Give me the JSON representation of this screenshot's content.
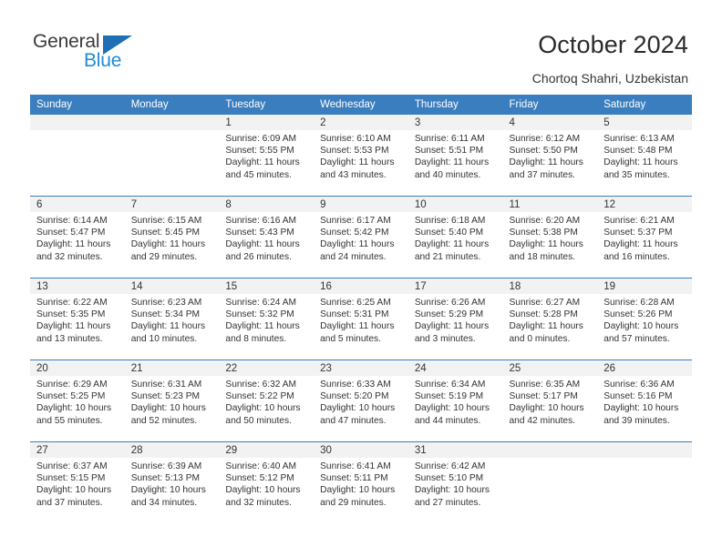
{
  "brand": {
    "name_top": "General",
    "name_bottom": "Blue",
    "accent_blue": "#1f8ad6",
    "triangle_blue": "#1f6fb5"
  },
  "header": {
    "title": "October 2024",
    "subtitle": "Chortoq Shahri, Uzbekistan",
    "header_bg": "#3a7ebf"
  },
  "calendar": {
    "weekday_headers": [
      "Sunday",
      "Monday",
      "Tuesday",
      "Wednesday",
      "Thursday",
      "Friday",
      "Saturday"
    ],
    "weeks": [
      [
        {
          "day": "",
          "sunrise": "",
          "sunset": "",
          "daylight_line1": "",
          "daylight_line2": ""
        },
        {
          "day": "",
          "sunrise": "",
          "sunset": "",
          "daylight_line1": "",
          "daylight_line2": ""
        },
        {
          "day": "1",
          "sunrise": "Sunrise: 6:09 AM",
          "sunset": "Sunset: 5:55 PM",
          "daylight_line1": "Daylight: 11 hours",
          "daylight_line2": "and 45 minutes."
        },
        {
          "day": "2",
          "sunrise": "Sunrise: 6:10 AM",
          "sunset": "Sunset: 5:53 PM",
          "daylight_line1": "Daylight: 11 hours",
          "daylight_line2": "and 43 minutes."
        },
        {
          "day": "3",
          "sunrise": "Sunrise: 6:11 AM",
          "sunset": "Sunset: 5:51 PM",
          "daylight_line1": "Daylight: 11 hours",
          "daylight_line2": "and 40 minutes."
        },
        {
          "day": "4",
          "sunrise": "Sunrise: 6:12 AM",
          "sunset": "Sunset: 5:50 PM",
          "daylight_line1": "Daylight: 11 hours",
          "daylight_line2": "and 37 minutes."
        },
        {
          "day": "5",
          "sunrise": "Sunrise: 6:13 AM",
          "sunset": "Sunset: 5:48 PM",
          "daylight_line1": "Daylight: 11 hours",
          "daylight_line2": "and 35 minutes."
        }
      ],
      [
        {
          "day": "6",
          "sunrise": "Sunrise: 6:14 AM",
          "sunset": "Sunset: 5:47 PM",
          "daylight_line1": "Daylight: 11 hours",
          "daylight_line2": "and 32 minutes."
        },
        {
          "day": "7",
          "sunrise": "Sunrise: 6:15 AM",
          "sunset": "Sunset: 5:45 PM",
          "daylight_line1": "Daylight: 11 hours",
          "daylight_line2": "and 29 minutes."
        },
        {
          "day": "8",
          "sunrise": "Sunrise: 6:16 AM",
          "sunset": "Sunset: 5:43 PM",
          "daylight_line1": "Daylight: 11 hours",
          "daylight_line2": "and 26 minutes."
        },
        {
          "day": "9",
          "sunrise": "Sunrise: 6:17 AM",
          "sunset": "Sunset: 5:42 PM",
          "daylight_line1": "Daylight: 11 hours",
          "daylight_line2": "and 24 minutes."
        },
        {
          "day": "10",
          "sunrise": "Sunrise: 6:18 AM",
          "sunset": "Sunset: 5:40 PM",
          "daylight_line1": "Daylight: 11 hours",
          "daylight_line2": "and 21 minutes."
        },
        {
          "day": "11",
          "sunrise": "Sunrise: 6:20 AM",
          "sunset": "Sunset: 5:38 PM",
          "daylight_line1": "Daylight: 11 hours",
          "daylight_line2": "and 18 minutes."
        },
        {
          "day": "12",
          "sunrise": "Sunrise: 6:21 AM",
          "sunset": "Sunset: 5:37 PM",
          "daylight_line1": "Daylight: 11 hours",
          "daylight_line2": "and 16 minutes."
        }
      ],
      [
        {
          "day": "13",
          "sunrise": "Sunrise: 6:22 AM",
          "sunset": "Sunset: 5:35 PM",
          "daylight_line1": "Daylight: 11 hours",
          "daylight_line2": "and 13 minutes."
        },
        {
          "day": "14",
          "sunrise": "Sunrise: 6:23 AM",
          "sunset": "Sunset: 5:34 PM",
          "daylight_line1": "Daylight: 11 hours",
          "daylight_line2": "and 10 minutes."
        },
        {
          "day": "15",
          "sunrise": "Sunrise: 6:24 AM",
          "sunset": "Sunset: 5:32 PM",
          "daylight_line1": "Daylight: 11 hours",
          "daylight_line2": "and 8 minutes."
        },
        {
          "day": "16",
          "sunrise": "Sunrise: 6:25 AM",
          "sunset": "Sunset: 5:31 PM",
          "daylight_line1": "Daylight: 11 hours",
          "daylight_line2": "and 5 minutes."
        },
        {
          "day": "17",
          "sunrise": "Sunrise: 6:26 AM",
          "sunset": "Sunset: 5:29 PM",
          "daylight_line1": "Daylight: 11 hours",
          "daylight_line2": "and 3 minutes."
        },
        {
          "day": "18",
          "sunrise": "Sunrise: 6:27 AM",
          "sunset": "Sunset: 5:28 PM",
          "daylight_line1": "Daylight: 11 hours",
          "daylight_line2": "and 0 minutes."
        },
        {
          "day": "19",
          "sunrise": "Sunrise: 6:28 AM",
          "sunset": "Sunset: 5:26 PM",
          "daylight_line1": "Daylight: 10 hours",
          "daylight_line2": "and 57 minutes."
        }
      ],
      [
        {
          "day": "20",
          "sunrise": "Sunrise: 6:29 AM",
          "sunset": "Sunset: 5:25 PM",
          "daylight_line1": "Daylight: 10 hours",
          "daylight_line2": "and 55 minutes."
        },
        {
          "day": "21",
          "sunrise": "Sunrise: 6:31 AM",
          "sunset": "Sunset: 5:23 PM",
          "daylight_line1": "Daylight: 10 hours",
          "daylight_line2": "and 52 minutes."
        },
        {
          "day": "22",
          "sunrise": "Sunrise: 6:32 AM",
          "sunset": "Sunset: 5:22 PM",
          "daylight_line1": "Daylight: 10 hours",
          "daylight_line2": "and 50 minutes."
        },
        {
          "day": "23",
          "sunrise": "Sunrise: 6:33 AM",
          "sunset": "Sunset: 5:20 PM",
          "daylight_line1": "Daylight: 10 hours",
          "daylight_line2": "and 47 minutes."
        },
        {
          "day": "24",
          "sunrise": "Sunrise: 6:34 AM",
          "sunset": "Sunset: 5:19 PM",
          "daylight_line1": "Daylight: 10 hours",
          "daylight_line2": "and 44 minutes."
        },
        {
          "day": "25",
          "sunrise": "Sunrise: 6:35 AM",
          "sunset": "Sunset: 5:17 PM",
          "daylight_line1": "Daylight: 10 hours",
          "daylight_line2": "and 42 minutes."
        },
        {
          "day": "26",
          "sunrise": "Sunrise: 6:36 AM",
          "sunset": "Sunset: 5:16 PM",
          "daylight_line1": "Daylight: 10 hours",
          "daylight_line2": "and 39 minutes."
        }
      ],
      [
        {
          "day": "27",
          "sunrise": "Sunrise: 6:37 AM",
          "sunset": "Sunset: 5:15 PM",
          "daylight_line1": "Daylight: 10 hours",
          "daylight_line2": "and 37 minutes."
        },
        {
          "day": "28",
          "sunrise": "Sunrise: 6:39 AM",
          "sunset": "Sunset: 5:13 PM",
          "daylight_line1": "Daylight: 10 hours",
          "daylight_line2": "and 34 minutes."
        },
        {
          "day": "29",
          "sunrise": "Sunrise: 6:40 AM",
          "sunset": "Sunset: 5:12 PM",
          "daylight_line1": "Daylight: 10 hours",
          "daylight_line2": "and 32 minutes."
        },
        {
          "day": "30",
          "sunrise": "Sunrise: 6:41 AM",
          "sunset": "Sunset: 5:11 PM",
          "daylight_line1": "Daylight: 10 hours",
          "daylight_line2": "and 29 minutes."
        },
        {
          "day": "31",
          "sunrise": "Sunrise: 6:42 AM",
          "sunset": "Sunset: 5:10 PM",
          "daylight_line1": "Daylight: 10 hours",
          "daylight_line2": "and 27 minutes."
        },
        {
          "day": "",
          "sunrise": "",
          "sunset": "",
          "daylight_line1": "",
          "daylight_line2": ""
        },
        {
          "day": "",
          "sunrise": "",
          "sunset": "",
          "daylight_line1": "",
          "daylight_line2": ""
        }
      ]
    ]
  }
}
